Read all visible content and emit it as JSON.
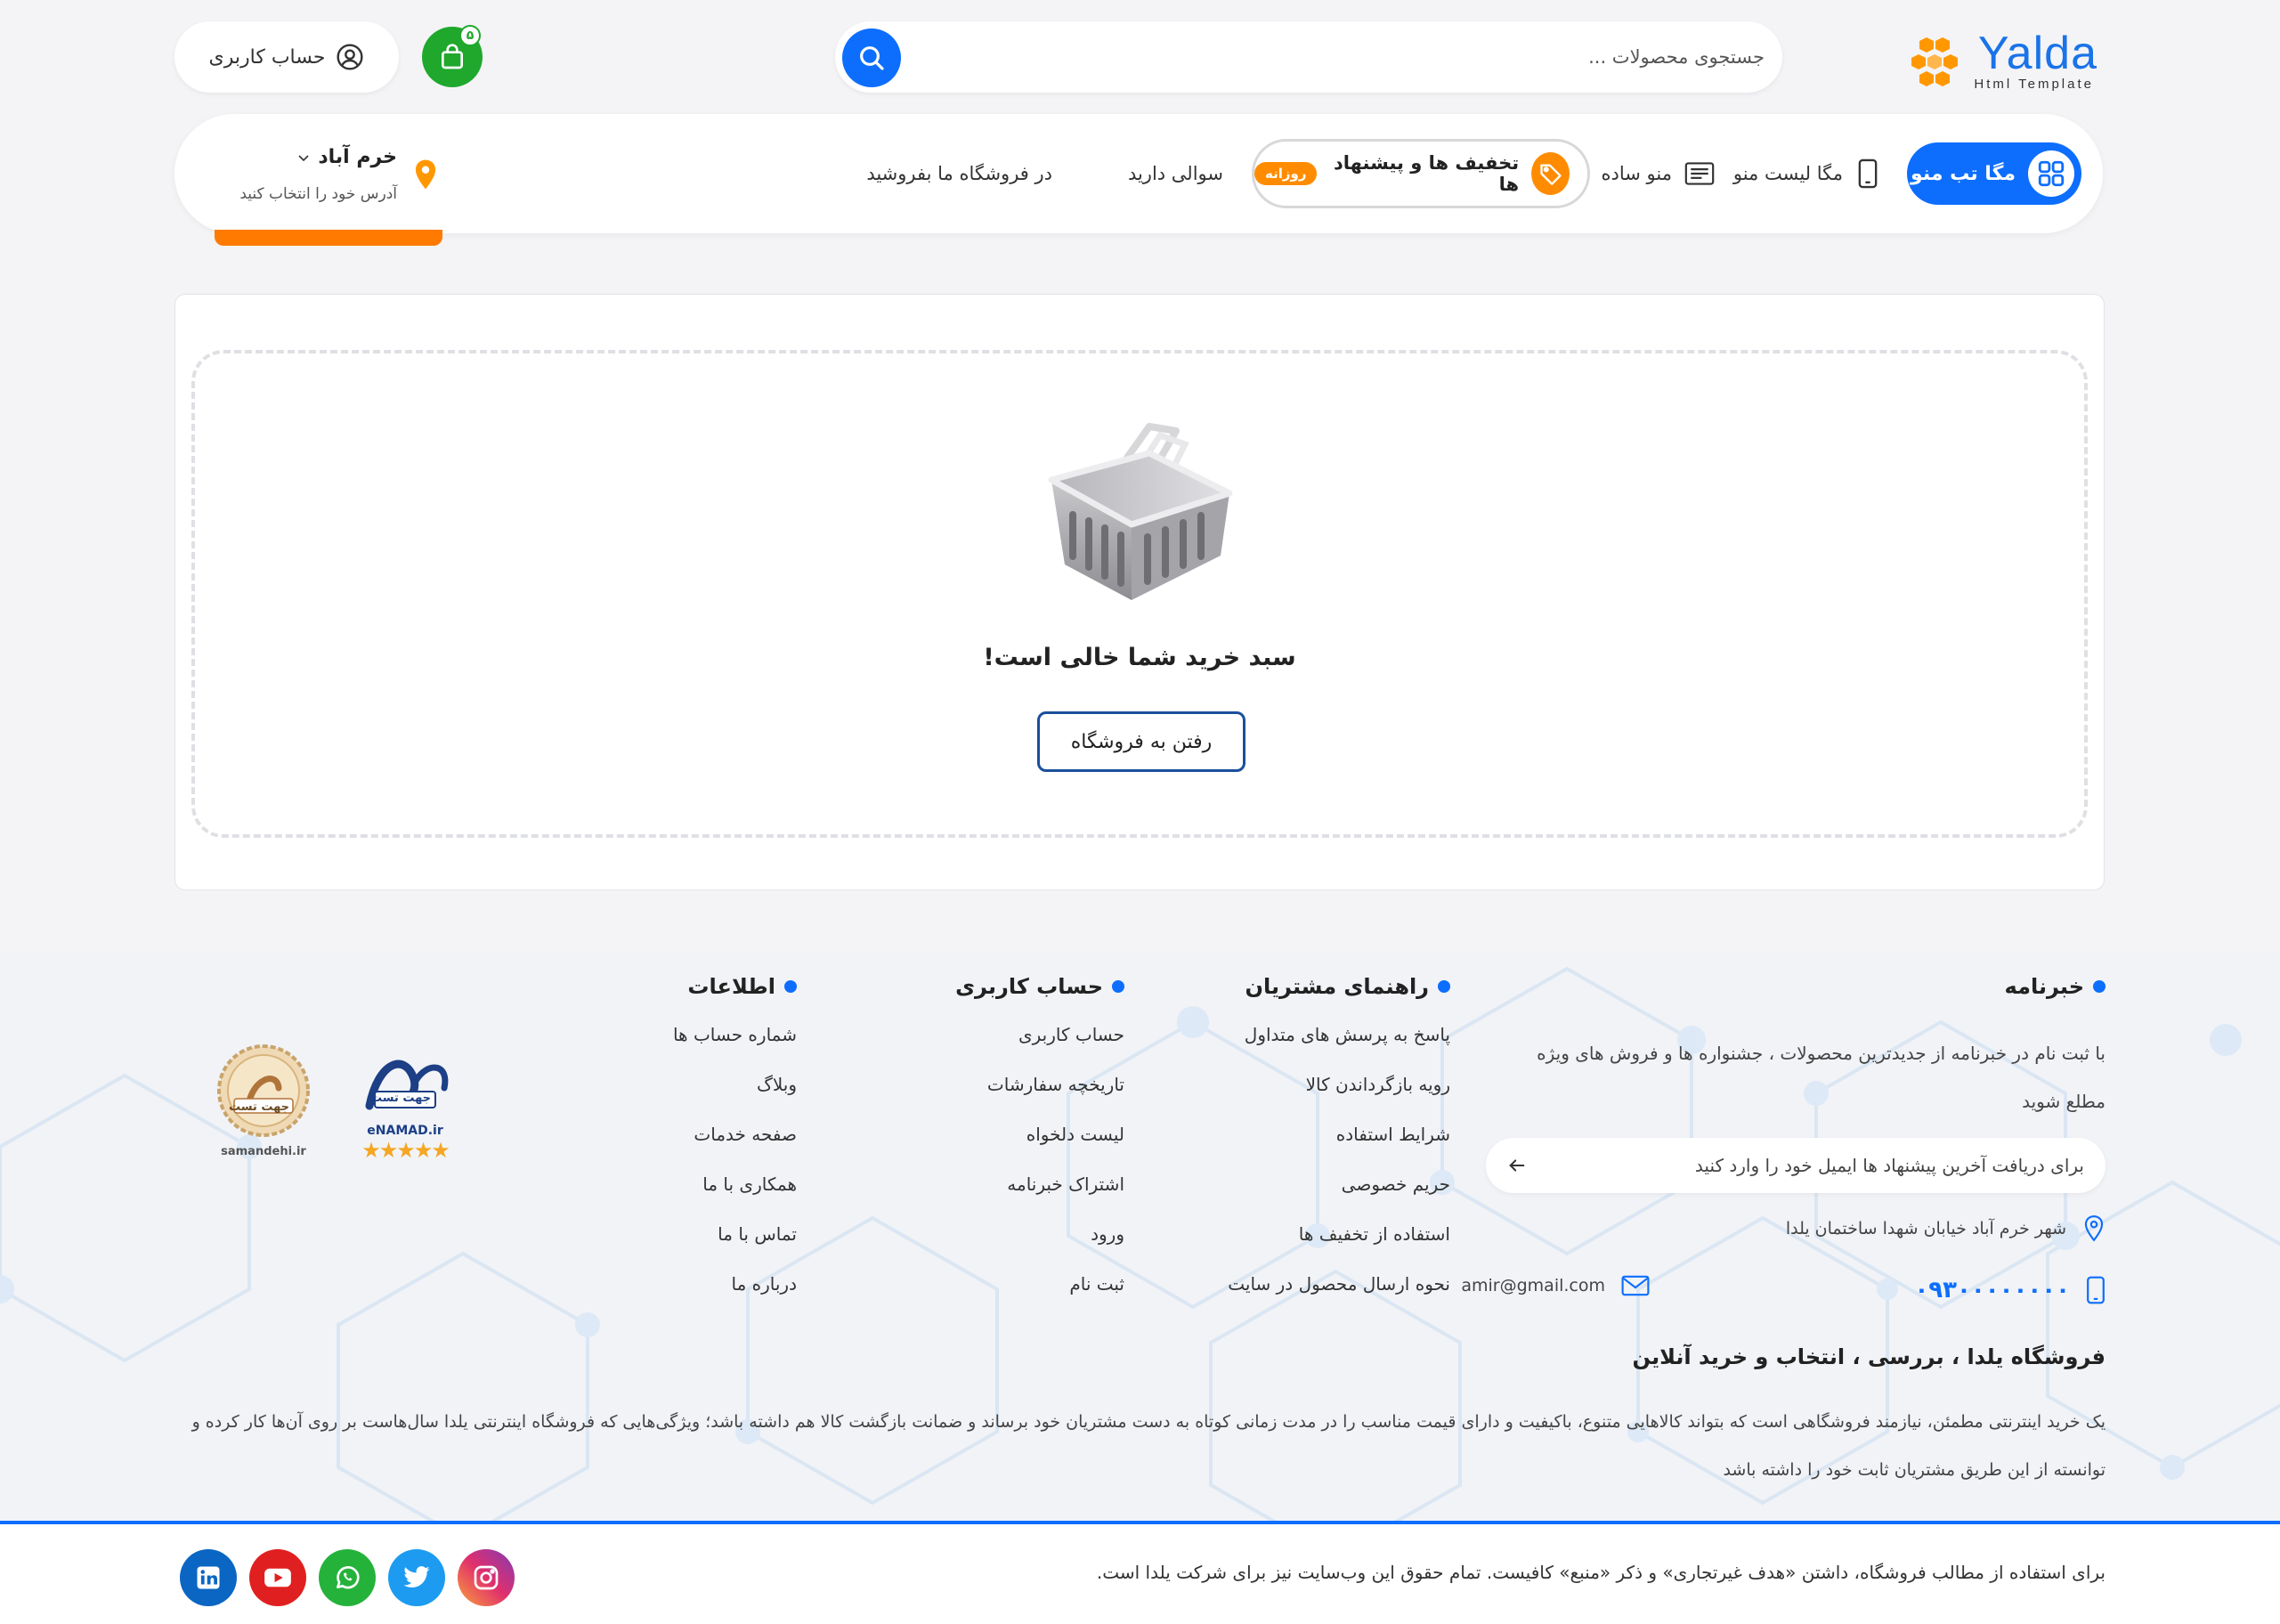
{
  "header": {
    "logo_text": "Yalda",
    "logo_sub": "Html Template",
    "search_placeholder": "جستجوی محصولات ...",
    "cart_count": "۵",
    "account_label": "حساب کاربری"
  },
  "nav": {
    "mega_tab": "مگا تب منو",
    "mega_list": "مگا لیست منو",
    "simple_menu": "منو ساده",
    "deals": "تخفیف ها و پیشنهاد ها",
    "deals_badge": "روزانه",
    "question": "سوالی دارید",
    "sell": "در فروشگاه ما بفروشید",
    "city": "خرم آباد",
    "city_sub": "آدرس خود را انتخاب کنید"
  },
  "cart": {
    "empty_title": "سبد خرید شما خالی است!",
    "shop_button": "رفتن به فروشگاه"
  },
  "footer": {
    "newsletter": {
      "title": "خبرنامه",
      "text": "با ثبت نام در خبرنامه از جدیدترین محصولات ، جشنواره ها و فروش های ویژه مطلع شوید",
      "input_placeholder": "برای دریافت آخرین پیشنهاد ها ایمیل خود را وارد کنید"
    },
    "address": "شهر خرم آباد خیابان شهدا ساختمان یلدا",
    "phone": "۰۹۳۰۰۰۰۰۰۰۰",
    "email": "amir@gmail.com",
    "guide": {
      "title": "راهنمای مشتریان",
      "items": [
        "پاسخ به پرسش های متداول",
        "رویه بازگرداندن کالا",
        "شرایط استفاده",
        "حریم خصوصی",
        "استفاده از تخفیف ها",
        "نحوه ارسال محصول در سایت"
      ]
    },
    "account": {
      "title": "حساب کاربری",
      "items": [
        "حساب کاربری",
        "تاریخچه سفارشات",
        "لیست دلخواه",
        "اشتراک خبرنامه",
        "ورود",
        "ثبت نام"
      ]
    },
    "info": {
      "title": "اطلاعات",
      "items": [
        "شماره حساب ها",
        "وبلاگ",
        "صفحه خدمات",
        "همکاری با ما",
        "تماس با ما",
        "درباره ما"
      ]
    },
    "badges": {
      "enamad_text": "eNAMAD.ir",
      "enamad_fa": "جهت تست",
      "samandehi_text": "samandehi.ir",
      "samandehi_fa": "جهت تست"
    },
    "about_title": "فروشگاه یلدا ، بررسی ، انتخاب و خرید آنلاین",
    "about_text": "یک خرید اینترنتی مطمئن، نیازمند فروشگاهی است که بتواند کالاهایی متنوع، باکیفیت و دارای قیمت مناسب را در مدت زمانی کوتاه به دست مشتریان خود برساند و ضمانت بازگشت کالا هم داشته باشد؛ ویژگی‌هایی که فروشگاه اینترنتی یلدا سال‌هاست بر روی آن‌ها کار کرده و توانسته از این طریق مشتریان ثابت خود را داشته باشد",
    "copyright": "برای استفاده از مطالب فروشگاه، داشتن «هدف غیرتجاری» و ذکر «منبع» کافیست. تمام حقوق این وب‌سایت نیز برای شرکت یلدا است."
  },
  "colors": {
    "primary": "#0d6efd",
    "cart_green": "#1fa82c",
    "accent_orange": "#ff8c00"
  },
  "icons": [
    "logo-hex-icon",
    "search-icon",
    "cart-bag-icon",
    "user-circle-icon",
    "grid-icon",
    "phone-outline-icon",
    "menu-lines-icon",
    "tag-icon",
    "chevron-down-icon",
    "map-pin-icon",
    "basket-icon",
    "arrow-left-icon",
    "mail-icon",
    "mobile-icon",
    "instagram-icon",
    "twitter-icon",
    "whatsapp-icon",
    "youtube-icon",
    "linkedin-icon"
  ]
}
